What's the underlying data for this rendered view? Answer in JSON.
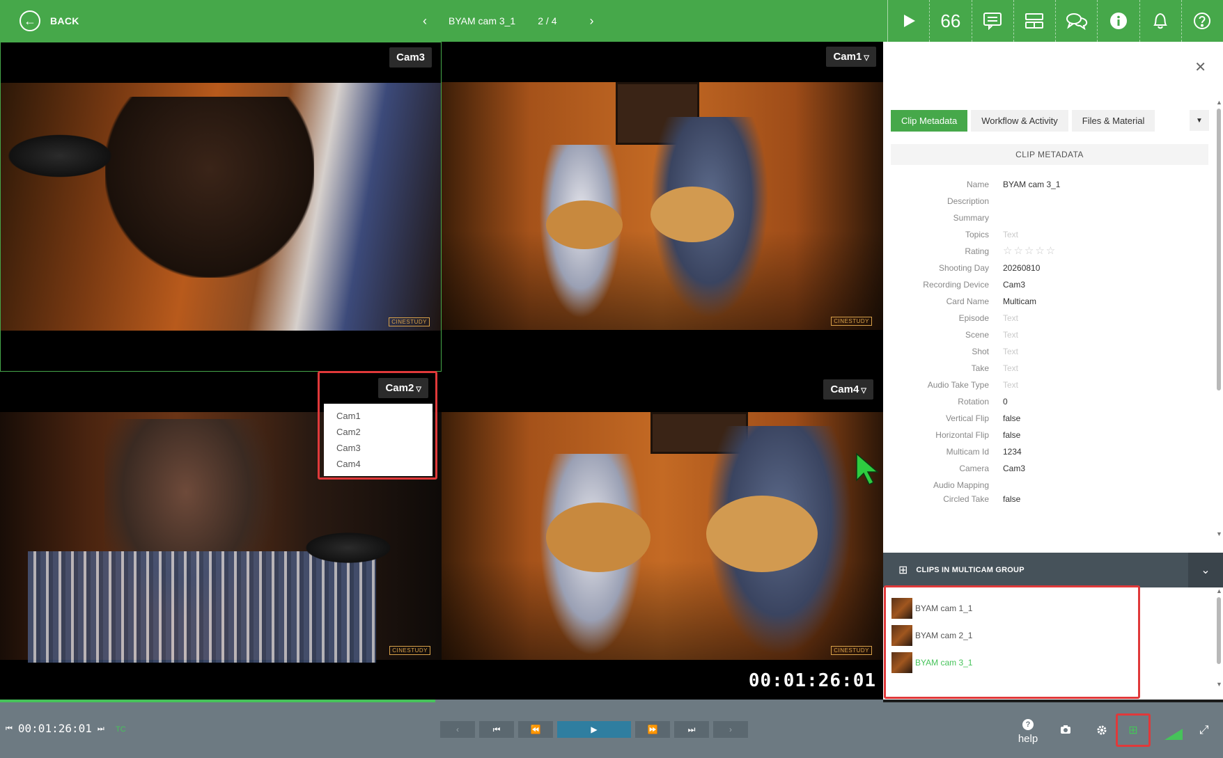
{
  "topbar": {
    "back_label": "BACK",
    "clip_title": "BYAM cam 3_1",
    "clip_position": "2 / 4",
    "tool_icons": [
      "play-icon",
      "quote-icon",
      "subtitles-icon",
      "layout-icon",
      "chat-icon",
      "info-icon",
      "bell-icon",
      "help-icon"
    ],
    "quote_glyph": "66"
  },
  "video": {
    "cells": [
      {
        "label": "Cam3",
        "has_dropdown": false
      },
      {
        "label": "Cam1",
        "has_dropdown": true
      },
      {
        "label": "Cam2",
        "has_dropdown": true
      },
      {
        "label": "Cam4",
        "has_dropdown": true
      }
    ],
    "watermark": "CINESTUDY",
    "timecode_overlay": "00:01:26:01",
    "cam_dropdown_options": [
      "Cam1",
      "Cam2",
      "Cam3",
      "Cam4"
    ],
    "progress_fraction": 0.493
  },
  "panel": {
    "tabs": [
      "Clip Metadata",
      "Workflow & Activity",
      "Files & Material"
    ],
    "active_tab": "Clip Metadata",
    "section_title": "CLIP METADATA",
    "fields": [
      {
        "key": "Name",
        "value": "BYAM cam 3_1"
      },
      {
        "key": "Description",
        "value": ""
      },
      {
        "key": "Summary",
        "value": ""
      },
      {
        "key": "Topics",
        "value": "Text",
        "placeholder": true
      },
      {
        "key": "Rating",
        "value": "",
        "stars": true
      },
      {
        "key": "Shooting Day",
        "value": "20260810"
      },
      {
        "key": "Recording Device",
        "value": "Cam3"
      },
      {
        "key": "Card Name",
        "value": "Multicam"
      },
      {
        "key": "Episode",
        "value": "Text",
        "placeholder": true
      },
      {
        "key": "Scene",
        "value": "Text",
        "placeholder": true
      },
      {
        "key": "Shot",
        "value": "Text",
        "placeholder": true
      },
      {
        "key": "Take",
        "value": "Text",
        "placeholder": true
      },
      {
        "key": "Audio Take Type",
        "value": "Text",
        "placeholder": true
      },
      {
        "key": "Rotation",
        "value": "0"
      },
      {
        "key": "Vertical Flip",
        "value": "false"
      },
      {
        "key": "Horizontal Flip",
        "value": "false"
      },
      {
        "key": "Multicam Id",
        "value": "1234"
      },
      {
        "key": "Camera",
        "value": "Cam3"
      },
      {
        "key": "Audio Mapping",
        "value": ""
      },
      {
        "key": "Circled Take",
        "value": "false"
      }
    ],
    "multicam_header": "CLIPS IN MULTICAM GROUP",
    "multicam_clips": [
      {
        "name": "BYAM cam 1_1",
        "current": false
      },
      {
        "name": "BYAM cam 2_1",
        "current": false
      },
      {
        "name": "BYAM cam 3_1",
        "current": true
      }
    ]
  },
  "bottombar": {
    "timecode": "00:01:26:01",
    "tc_mode": "TC",
    "help_label": "help",
    "accent": "#46a84a",
    "highlight": "#e0393a"
  }
}
